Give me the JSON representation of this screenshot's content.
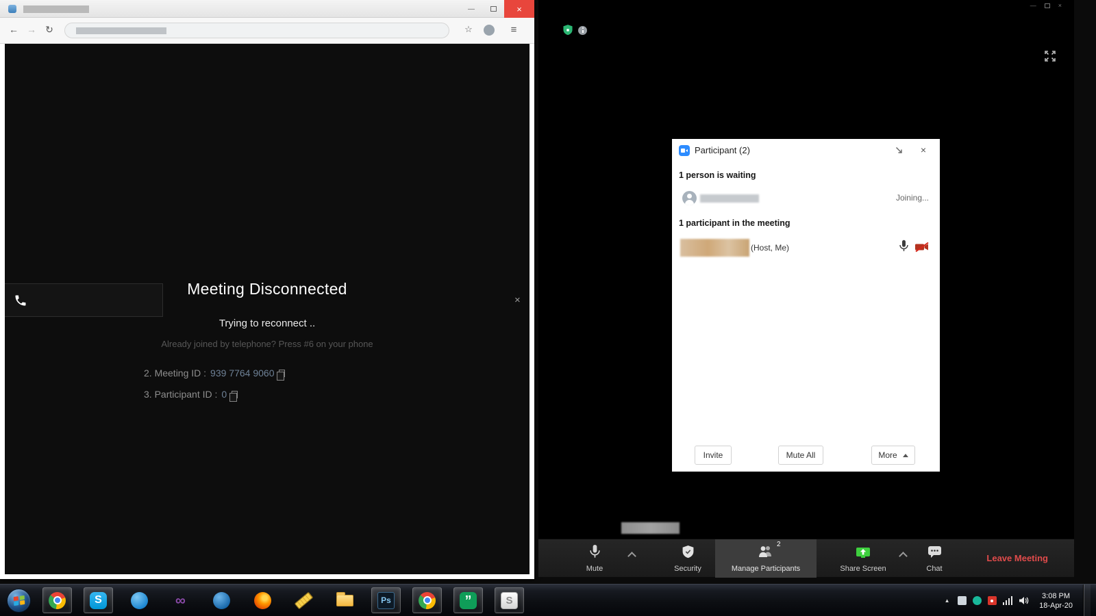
{
  "browser_window": {
    "title_bar": {
      "minimize": "—",
      "close": "×"
    },
    "toolbar": {
      "back": "←",
      "forward": "→",
      "reload": "↻",
      "menu": "≡",
      "star": "☆"
    },
    "page": {
      "disconnect_title": "Meeting Disconnected",
      "reconnect_text": "Trying to reconnect ..",
      "phone_hint": "Already joined by telephone? Press #6 on your phone",
      "meeting_id_label": "2. Meeting ID :",
      "meeting_id_value": "939 7764 9060",
      "participant_id_label": "3. Participant ID :",
      "participant_id_value": "0",
      "dismiss": "×"
    }
  },
  "zoom_window": {
    "title_bar": {
      "minimize": "—",
      "close": "×"
    },
    "participants_panel": {
      "title": "Participant (2)",
      "close": "×",
      "waiting_header": "1 person is waiting",
      "waiting_status": "Joining...",
      "in_meeting_header": "1 participant in the meeting",
      "host_suffix": "(Host, Me)",
      "buttons": {
        "invite": "Invite",
        "mute_all": "Mute All",
        "more": "More"
      }
    },
    "toolbar": {
      "mute": "Mute",
      "security": "Security",
      "manage_participants": "Manage Participants",
      "badge": "2",
      "share_screen": "Share Screen",
      "chat": "Chat",
      "leave": "Leave Meeting"
    }
  },
  "taskbar": {
    "tray_expand": "▲",
    "clock": {
      "time": "3:08 PM",
      "date": "18-Apr-20"
    },
    "icons": [
      {
        "name": "chrome"
      },
      {
        "name": "skype",
        "glyph": "S"
      },
      {
        "name": "messenger"
      },
      {
        "name": "visual-studio",
        "glyph": "∞"
      },
      {
        "name": "blue-app"
      },
      {
        "name": "firefox"
      },
      {
        "name": "screen-ruler"
      },
      {
        "name": "file-explorer"
      },
      {
        "name": "photoshop",
        "glyph": "Ps"
      },
      {
        "name": "chrome-2"
      },
      {
        "name": "hangouts",
        "glyph": "”"
      },
      {
        "name": "screenpresso",
        "glyph": "S"
      }
    ]
  }
}
